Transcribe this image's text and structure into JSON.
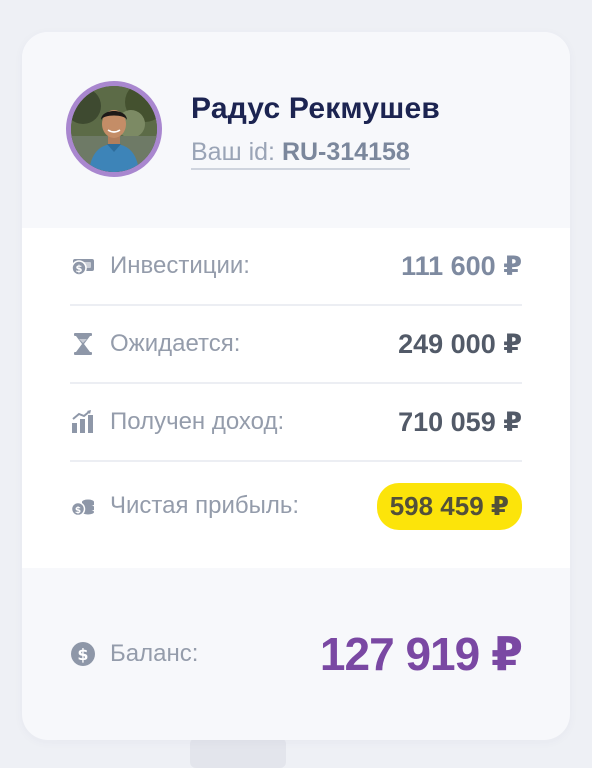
{
  "profile": {
    "name": "Радус Рекмушев",
    "id_label": "Ваш id:",
    "id_value": "RU-314158"
  },
  "stats": [
    {
      "label": "Инвестиции:",
      "value": "111 600 ₽",
      "icon": "money-stack-icon"
    },
    {
      "label": "Ожидается:",
      "value": "249 000 ₽",
      "icon": "hourglass-icon"
    },
    {
      "label": "Получен доход:",
      "value": "710 059 ₽",
      "icon": "bar-chart-icon"
    },
    {
      "label": "Чистая прибыль:",
      "value": "598 459 ₽",
      "icon": "coins-icon"
    }
  ],
  "balance": {
    "label": "Баланс:",
    "value": "127 919 ₽",
    "icon": "dollar-circle-icon"
  },
  "colors": {
    "accent": "#7a48a3",
    "highlight": "#fce40a",
    "avatar_ring": "#a987cf",
    "name": "#1c2451"
  }
}
